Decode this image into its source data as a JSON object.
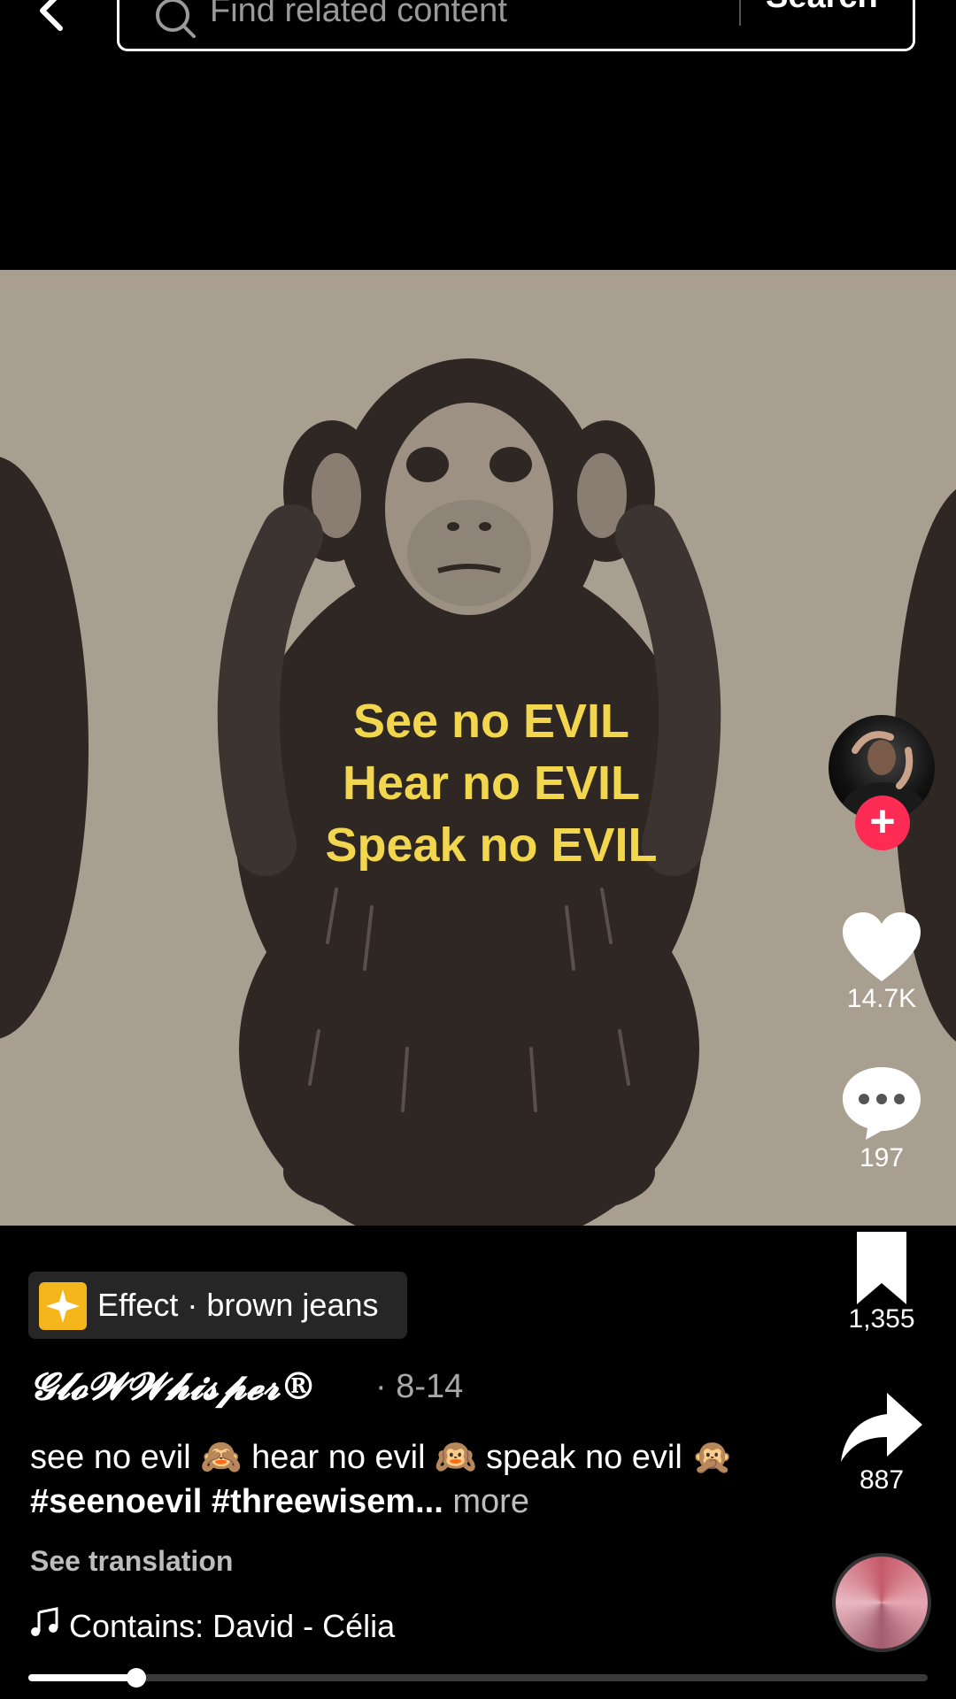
{
  "search": {
    "placeholder": "Find related content",
    "button_label": "Search"
  },
  "video": {
    "overlay_lines": [
      "See no EVIL",
      "Hear no EVIL",
      "Speak no EVIL"
    ],
    "overlay_color": "#f2d64e",
    "background": "#a89f91"
  },
  "rail": {
    "likes": "14.7K",
    "comments": "197",
    "saves": "1,355",
    "shares": "887",
    "follow_symbol": "+"
  },
  "effect": {
    "label": "Effect · brown jeans"
  },
  "post": {
    "author": "𝓖𝓵𝓸𝓦𝓦𝓱𝓲𝓼𝓹𝓮𝓻®",
    "date": "· 8-14",
    "caption_text": "see no evil 🙈 hear no evil 🙉 speak no evil 🙊 ",
    "caption_tags": "#seenoevil #threewisem...",
    "caption_more": "more",
    "see_translation": "See translation",
    "music": "Contains: David - Célia"
  },
  "progress": {
    "fraction": 0.12
  },
  "icons": [
    "back-arrow-icon",
    "search-icon",
    "heart-icon",
    "comment-icon",
    "bookmark-icon",
    "share-icon",
    "music-note-icon",
    "effect-sparkle-icon"
  ]
}
